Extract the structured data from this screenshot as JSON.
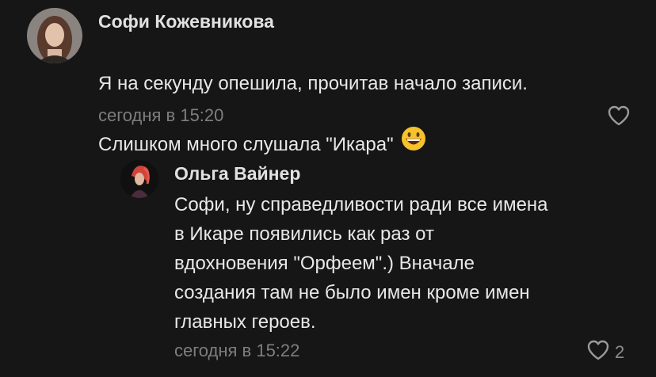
{
  "comments": [
    {
      "author": "Софи Кожевникова",
      "text_line1": "Я на секунду опешила, прочитав начало записи.",
      "text_line2": "Слишком много слушала \"Икара\"",
      "emoji": "grinning-face-emoji",
      "time": "сегодня в 15:20",
      "likes": ""
    },
    {
      "author": "Ольга Вайнер",
      "text": "Софи, ну справедливости ради все имена\nв Икаре появились как раз от\nвдохновения \"Орфеем\".) Вначале\nсоздания там не было имен кроме имен\nглавных героев.",
      "time": "сегодня в 15:22",
      "likes": "2"
    }
  ],
  "icons": {
    "like": "heart-outline-icon"
  },
  "colors": {
    "background": "#161616",
    "text": "#e8e8e8",
    "meta": "#7e7e7e"
  }
}
